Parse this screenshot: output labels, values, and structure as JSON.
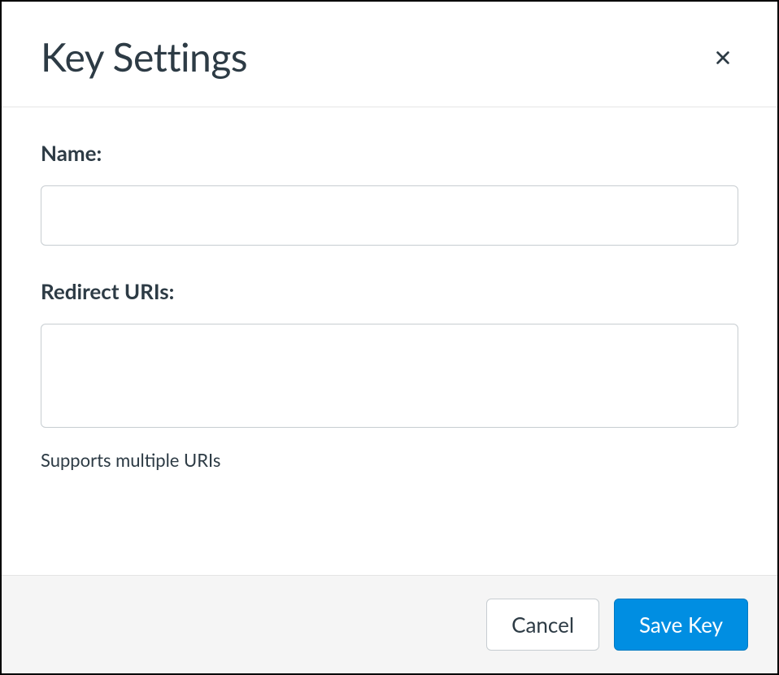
{
  "modal": {
    "title": "Key Settings"
  },
  "form": {
    "name_label": "Name:",
    "name_value": "",
    "redirect_label": "Redirect URIs:",
    "redirect_value": "",
    "redirect_help": "Supports multiple URIs"
  },
  "footer": {
    "cancel_label": "Cancel",
    "save_label": "Save Key"
  },
  "colors": {
    "text_dark": "#2d3b45",
    "border_gray": "#c7cdd1",
    "primary_blue": "#008ee2",
    "footer_bg": "#f5f5f5"
  }
}
